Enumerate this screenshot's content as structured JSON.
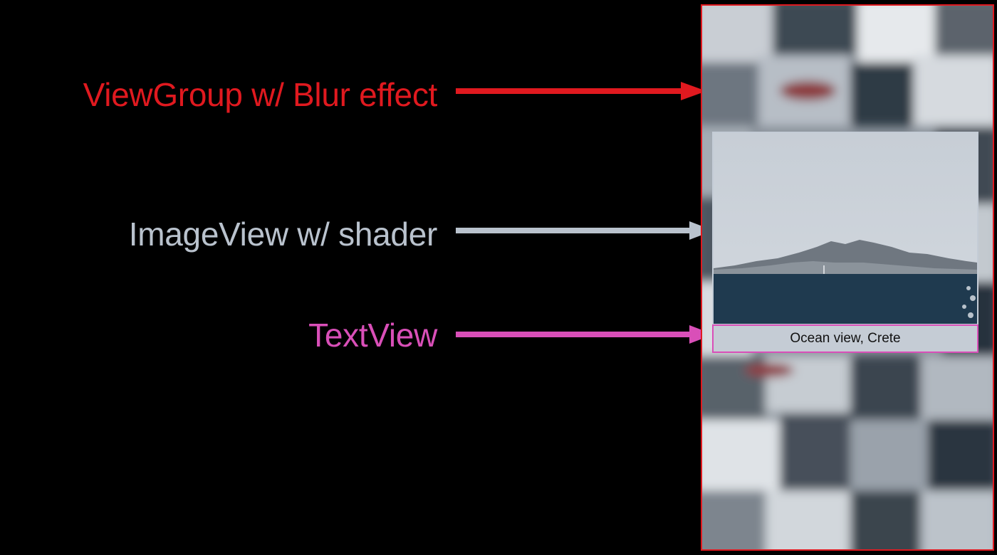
{
  "labels": {
    "viewgroup": "ViewGroup w/ Blur effect",
    "imageview": "ImageView w/ shader",
    "textview": "TextView"
  },
  "caption": "Ocean view, Crete",
  "colors": {
    "background": "#000000",
    "viewgroup": "#e0191f",
    "imageview": "#b9c2cd",
    "textview": "#d94fb8",
    "sea": "#1f3a4f",
    "sky": "#c9d0d8",
    "mountains": "#6f7780"
  }
}
